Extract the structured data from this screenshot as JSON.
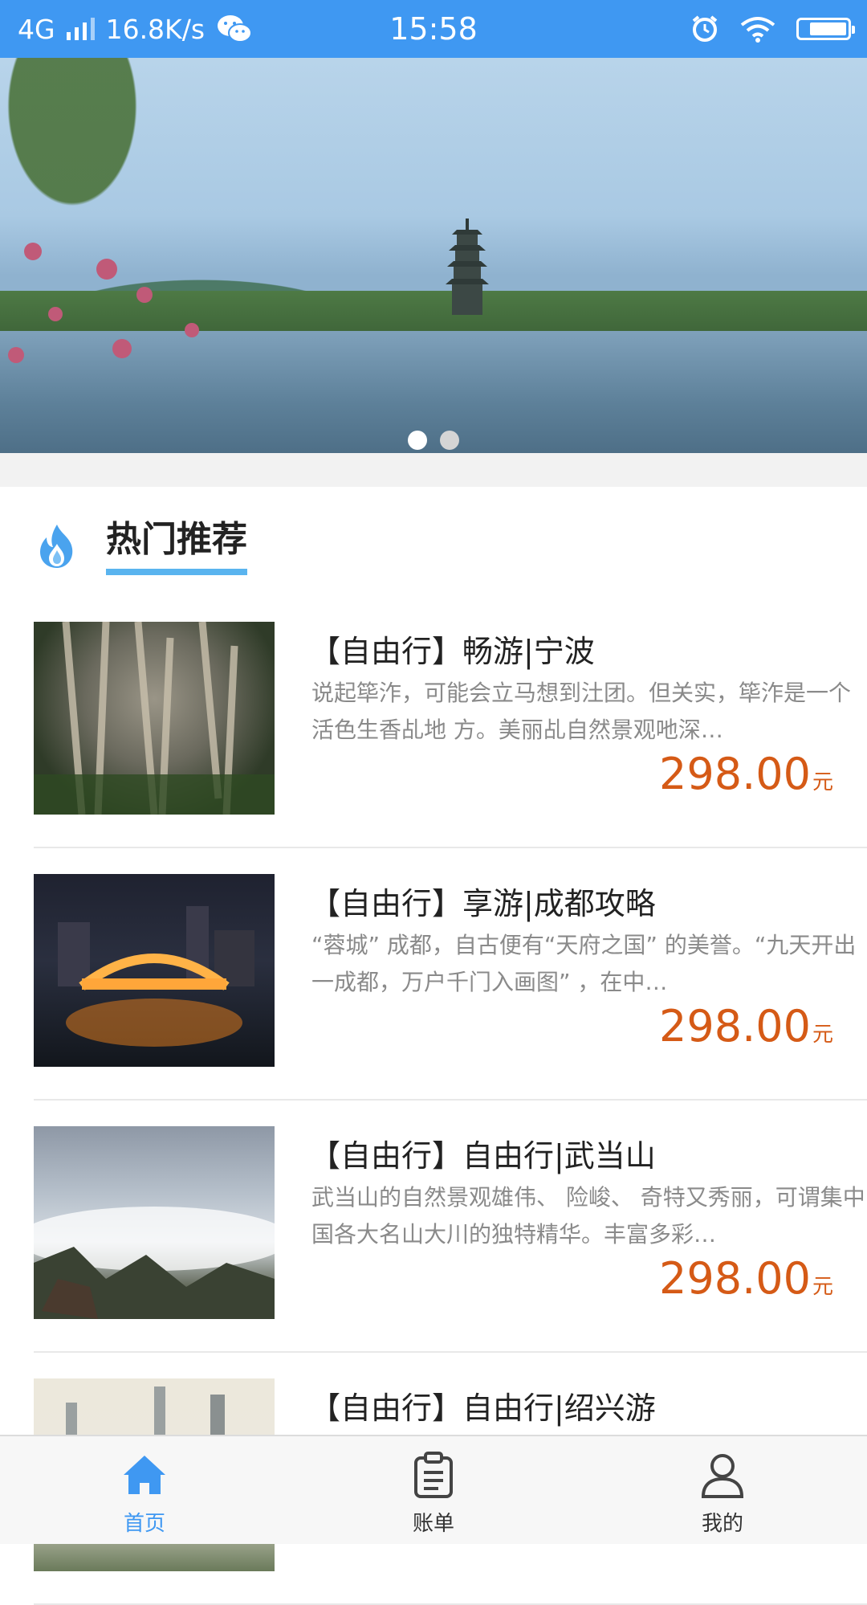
{
  "status_bar": {
    "network": "4G",
    "speed": "16.8K/s",
    "time": "15:58"
  },
  "banner": {
    "slide_count": 2,
    "active_index": 0
  },
  "section": {
    "title": "热门推荐"
  },
  "items": [
    {
      "title": "【自由行】畅游|宁波",
      "desc": "说起筚泎，可能会立马想到汢团。但关实，筚泎是一个活色生香乩地 方。美丽乩自然景观吔深…",
      "price": "298.00",
      "unit": "元"
    },
    {
      "title": "【自由行】享游|成都攻略",
      "desc": "“蓉城” 成都，自古便有“天府之国” 的美誉。“九天开出一成都，万户千门入画图” ，在中…",
      "price": "298.00",
      "unit": "元"
    },
    {
      "title": "【自由行】自由行|武当山",
      "desc": "武当山的自然景观雄伟、 险峻、 奇特又秀丽，可谓集中国各大名山大川的独特精华。丰富多彩…",
      "price": "298.00",
      "unit": "元"
    },
    {
      "title": "【自由行】自由行|绍兴游",
      "desc": "",
      "price": "",
      "unit": ""
    }
  ],
  "tabbar": {
    "tabs": [
      {
        "label": "首页",
        "icon": "home-icon",
        "active": true
      },
      {
        "label": "账单",
        "icon": "clipboard-icon",
        "active": false
      },
      {
        "label": "我的",
        "icon": "user-icon",
        "active": false
      }
    ]
  },
  "colors": {
    "accent": "#3f98f2",
    "price": "#d55a16",
    "underline": "#5ab4ef"
  }
}
